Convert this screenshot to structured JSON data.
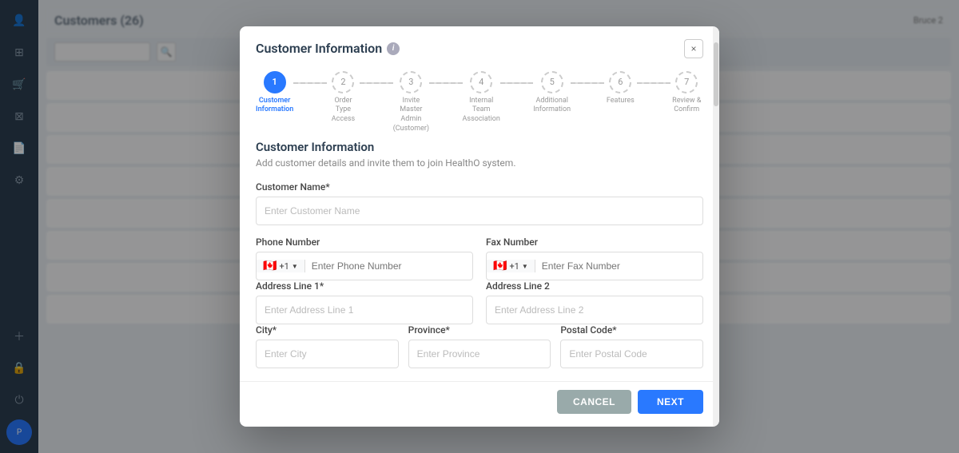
{
  "app": {
    "title": "Customers (26)",
    "user": "Bruce 2"
  },
  "modal": {
    "title": "Customer Information",
    "close_label": "×",
    "section_title": "Customer Information",
    "section_subtitle": "Add customer details and invite them to join HealthO system.",
    "steps": [
      {
        "number": "1",
        "label": "Customer\nInformation",
        "active": true
      },
      {
        "number": "2",
        "label": "Order Type Access",
        "active": false
      },
      {
        "number": "3",
        "label": "Invite Master\nAdmin (Customer)",
        "active": false
      },
      {
        "number": "4",
        "label": "Internal Team\nAssociation",
        "active": false
      },
      {
        "number": "5",
        "label": "Additional\nInformation",
        "active": false
      },
      {
        "number": "6",
        "label": "Features",
        "active": false
      },
      {
        "number": "7",
        "label": "Review & Confirm",
        "active": false
      }
    ],
    "fields": {
      "customer_name_label": "Customer Name*",
      "customer_name_placeholder": "Enter Customer Name",
      "phone_label": "Phone Number",
      "phone_placeholder": "Enter Phone Number",
      "phone_code": "+1",
      "fax_label": "Fax Number",
      "fax_placeholder": "Enter Fax Number",
      "fax_code": "+1",
      "address1_label": "Address Line 1*",
      "address1_placeholder": "Enter Address Line 1",
      "address2_label": "Address Line 2",
      "address2_placeholder": "Enter Address Line 2",
      "city_label": "City*",
      "city_placeholder": "Enter City",
      "province_label": "Province*",
      "province_placeholder": "Enter Province",
      "postal_label": "Postal Code*",
      "postal_placeholder": "Enter Postal Code"
    },
    "buttons": {
      "cancel": "CANCEL",
      "next": "NEXT"
    }
  }
}
